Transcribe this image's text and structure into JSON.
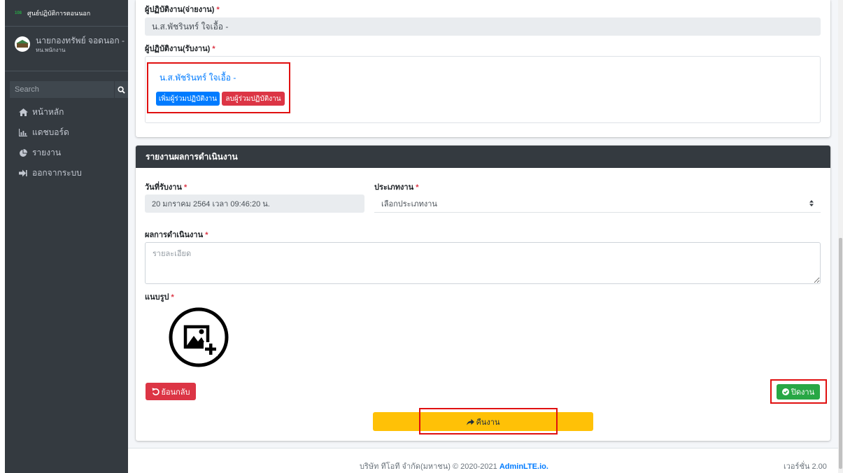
{
  "sidebar": {
    "brand": "ศูนย์ปฏิบัติการตอนนอก",
    "brand_logo": "108",
    "user": {
      "name": "นายกองทรัพย์ จอดนอก -",
      "role": "หน.พนักงาน"
    },
    "search": {
      "placeholder": "Search"
    },
    "nav": [
      {
        "icon": "home-icon",
        "label": "หน้าหลัก"
      },
      {
        "icon": "dashboard-icon",
        "label": "แดชบอร์ด"
      },
      {
        "icon": "pie-chart-icon",
        "label": "รายงาน"
      },
      {
        "icon": "logout-icon",
        "label": "ออกจากระบบ"
      }
    ]
  },
  "assign": {
    "giver_label": "ผู้ปฏิบัติงาน(จ่ายงาน)",
    "giver_value": "น.ส.พัชรินทร์ ใจเอื้อ -",
    "receiver_label": "ผู้ปฏิบัติงาน(รับงาน)",
    "receiver_value": "น.ส.พัชรินทร์ ใจเอื้อ -",
    "add_button": "เพิ่มผู้ร่วมปฏิบัติงาน",
    "remove_button": "ลบผู้ร่วมปฏิบัติงาน"
  },
  "report": {
    "header": "รายงานผลการดำเนินงาน",
    "date_label": "วันที่รับงาน",
    "date_value": "20 มกราคม 2564 เวลา 09:46:20 น.",
    "type_label": "ประเภทงาน",
    "type_selected": "เลือกประเภทงาน",
    "result_label": "ผลการดำเนินงาน",
    "result_placeholder": "รายละเอียด",
    "attach_label": "แนบรูป",
    "back_button": "ย้อนกลับ",
    "close_button": "ปิดงาน",
    "return_button": "คืนงาน"
  },
  "footer": {
    "copyright": "บริษัท ทีโอที จำกัด(มหาชน) © 2020-2021",
    "link": "AdminLTE.io.",
    "version": "เวอร์ชั่น 2.00"
  },
  "colors": {
    "sidebar_bg": "#343a40",
    "primary": "#007bff",
    "danger": "#dc3545",
    "success": "#28a745",
    "warning": "#ffc107",
    "highlight_box": "#e01010"
  }
}
